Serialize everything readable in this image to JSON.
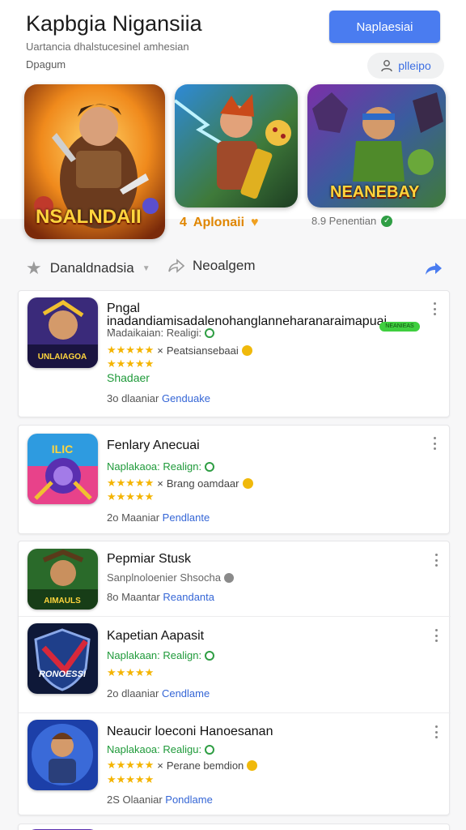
{
  "header": {
    "title": "Kapbgia Nigansiia",
    "subtitle": "Uartancia dhalstucesinel amhesian",
    "category": "Dpagum",
    "primary_button": "Naplaesiai",
    "user_chip": "plleipo"
  },
  "banners": [
    {
      "label": "NSALNDAII"
    },
    {
      "label": "Aplonaii",
      "caption_prefix": "4"
    },
    {
      "label": "NEANEBAY",
      "caption": "8.9 Penentian"
    }
  ],
  "filters": {
    "first": "Danaldnadsia",
    "second": "Neoalgem"
  },
  "apps": [
    {
      "name": "Pngal inadandiamisadalenohanglanneharanaraimapuai dnaurar",
      "developer": "Madaikaian: Realigi:",
      "rating_meta": "Peatsiansebaai",
      "tag": "NEANIEAS",
      "genre": "Shadaer",
      "footer_count": "3o dlaaniar",
      "footer_link": "Genduake",
      "icon_label": "UNLAIAGOA"
    },
    {
      "name": "Fenlary Anecuai",
      "developer": "Naplakaoa: Realign:",
      "rating_meta": "Brang oamdaar",
      "footer_count": "2o Maaniar",
      "footer_link": "Pendlante",
      "icon_label": "ILIC"
    },
    {
      "name": "Pepmiar Stusk",
      "developer": "Sanplnoloenier Shsocha",
      "footer_count": "8o Maantar",
      "footer_link": "Reandanta",
      "icon_label": "AIMAULS"
    },
    {
      "name": "Kapetian Aapasit",
      "developer": "Naplakaan: Realign:",
      "footer_count": "2o dlaaniar",
      "footer_link": "Cendlame",
      "icon_label": "RONOESSI"
    },
    {
      "name": "Neaucir loeconi Hanoesanan",
      "developer": "Naplakaoa: Realigu:",
      "rating_meta": "Perane bemdion",
      "footer_count": "2S Olaaniar",
      "footer_link": "Pondlame",
      "icon_label": ""
    }
  ],
  "stars": "★★★★★",
  "stars_second_row": "★★★★★",
  "colors": {
    "accent": "#4a7cf0",
    "link": "#3566d6",
    "developer_green": "#1f9a3a",
    "star": "#f4b400"
  }
}
